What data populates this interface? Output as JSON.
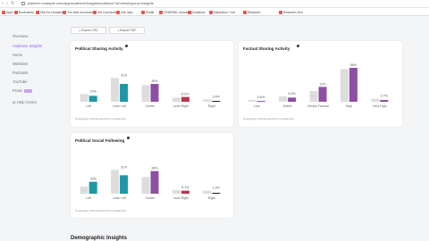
{
  "browser": {
    "url": "platform.example.com/app/audience/insights/audience?id=view&query=insights",
    "bookmarks": [
      "Apps",
      "Bookmarks",
      "Hub for education",
      "The best resources",
      "Set-Connections",
      "Use clips",
      "Kindle",
      "GENERAL resources",
      "Curations",
      "Inspiration + fun",
      "Research",
      "Research Tool"
    ]
  },
  "sidebar": {
    "items": [
      {
        "label": "Overview"
      },
      {
        "label": "Audience Insights",
        "active": true
      },
      {
        "label": "Home"
      },
      {
        "label": "Websites"
      },
      {
        "label": "Podcasts"
      },
      {
        "label": "YouTube"
      },
      {
        "label": "Prose",
        "badge": true
      },
      {
        "label": "Help Center",
        "icon": true
      }
    ]
  },
  "toolbar": {
    "export_csv": "Export CSV",
    "export_pdf": "Export PDF"
  },
  "cards": {
    "political_sharing": {
      "title": "Political Sharing Activity",
      "footnote": "% average of all accounts (for comparison)"
    },
    "factual_sharing": {
      "title": "Factual Sharing Activity",
      "footnote": "% average of all accounts (for comparison)"
    },
    "political_following": {
      "title": "Political Social Following",
      "footnote": "% average of all accounts (for comparison)"
    }
  },
  "section_peek": "Demographic Insights",
  "colors": {
    "baseline": "#dddddd",
    "teal": "#1f97a5",
    "purple": "#8c4fa3",
    "red": "#b5364d",
    "black": "#222222"
  },
  "chart_data": [
    {
      "type": "bar",
      "title": "Political Sharing Activity",
      "categories": [
        "Left",
        "Lean Left",
        "Center",
        "Lean Right",
        "Right"
      ],
      "series": [
        {
          "values": [
            13,
            40,
            28,
            7,
            4
          ]
        },
        {
          "values": [
            10,
            30,
            30,
            8,
            1
          ]
        }
      ],
      "labels": [
        "10%",
        "31%",
        "38%",
        "8.5%",
        "3.4%"
      ],
      "highlight_colors": [
        "teal",
        "teal",
        "purple",
        "red",
        "black"
      ]
    },
    {
      "type": "bar",
      "title": "Factual Sharing Activity",
      "categories": [
        "Low",
        "Mixed",
        "Mostly Factual",
        "High",
        "Very High"
      ],
      "series": [
        {
          "values": [
            3,
            9,
            18,
            55,
            5
          ]
        },
        {
          "values": [
            1,
            7,
            25,
            57,
            3
          ]
        }
      ],
      "labels": [
        "0.6%",
        "8.5%",
        "13%",
        "56%",
        "2.7%"
      ],
      "highlight_colors": [
        "purple",
        "purple",
        "purple",
        "purple",
        "purple"
      ]
    },
    {
      "type": "bar",
      "title": "Political Social Following",
      "categories": [
        "Left",
        "Lean Left",
        "Center",
        "Lean Right",
        "Right"
      ],
      "series": [
        {
          "values": [
            12,
            40,
            28,
            6,
            5
          ]
        },
        {
          "values": [
            20,
            31,
            38,
            5,
            1.5
          ]
        }
      ],
      "labels": [
        "20%",
        "31%",
        "38%",
        "5.1%",
        "1.5%"
      ],
      "highlight_colors": [
        "teal",
        "teal",
        "purple",
        "red",
        "black"
      ]
    }
  ]
}
